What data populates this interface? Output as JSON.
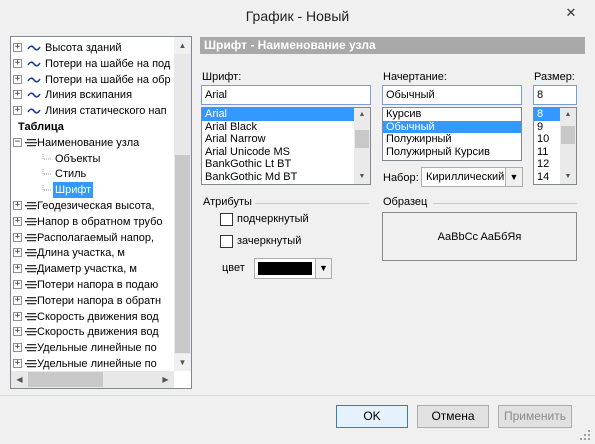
{
  "window": {
    "title": "График - Новый",
    "close_glyph": "✕"
  },
  "tree": {
    "items": [
      {
        "label": "Высота зданий",
        "kind": "series",
        "expander": "+"
      },
      {
        "label": "Потери на шайбе на под",
        "kind": "series",
        "expander": "+"
      },
      {
        "label": "Потери на шайбе на обр",
        "kind": "series",
        "expander": "+"
      },
      {
        "label": "Линия вскипания",
        "kind": "series",
        "expander": "+"
      },
      {
        "label": "Линия статического нап",
        "kind": "series",
        "expander": "+"
      },
      {
        "label": "Таблица",
        "kind": "heading"
      },
      {
        "label": "Наименование узла",
        "kind": "table-row",
        "expander": "−"
      },
      {
        "label": "Объекты",
        "kind": "child"
      },
      {
        "label": "Стиль",
        "kind": "child"
      },
      {
        "label": "Шрифт",
        "kind": "child",
        "selected": true
      },
      {
        "label": "Геодезическая высота,",
        "kind": "table-row",
        "expander": "+"
      },
      {
        "label": "Напор в обратном трубо",
        "kind": "table-row",
        "expander": "+"
      },
      {
        "label": "Располагаемый напор,",
        "kind": "table-row",
        "expander": "+"
      },
      {
        "label": "Длина участка, м",
        "kind": "table-row",
        "expander": "+"
      },
      {
        "label": "Диаметр участка, м",
        "kind": "table-row",
        "expander": "+"
      },
      {
        "label": "Потери напора в подаю",
        "kind": "table-row",
        "expander": "+"
      },
      {
        "label": "Потери напора в обратн",
        "kind": "table-row",
        "expander": "+"
      },
      {
        "label": "Скорость движения вод",
        "kind": "table-row",
        "expander": "+"
      },
      {
        "label": "Скорость движения вод",
        "kind": "table-row",
        "expander": "+"
      },
      {
        "label": "Удельные линейные по",
        "kind": "table-row",
        "expander": "+"
      },
      {
        "label": "Удельные линейные по",
        "kind": "table-row",
        "expander": "+"
      }
    ]
  },
  "panel": {
    "header": "Шрифт - Наименование узла",
    "font": {
      "label": "Шрифт:",
      "value": "Arial",
      "options": [
        "Arial",
        "Arial Black",
        "Arial Narrow",
        "Arial Unicode MS",
        "BankGothic Lt BT",
        "BankGothic Md BT"
      ],
      "selected": "Arial"
    },
    "style": {
      "label": "Начертание:",
      "value": "Обычный",
      "options": [
        "Курсив",
        "Обычный",
        "Полужирный",
        "Полужирный Курсив"
      ],
      "selected": "Обычный"
    },
    "size": {
      "label": "Размер:",
      "value": "8",
      "options": [
        "8",
        "9",
        "10",
        "11",
        "12",
        "14"
      ],
      "selected": "8"
    },
    "charset": {
      "label": "Набор:",
      "value": "Кириллический"
    },
    "attributes": {
      "label": "Атрибуты",
      "underline": {
        "label": "подчеркнутый",
        "checked": false
      },
      "strikeout": {
        "label": "зачеркнутый",
        "checked": false
      },
      "color": {
        "label": "цвет",
        "value": "#000000"
      }
    },
    "sample": {
      "label": "Образец",
      "text": "AaBbCc AaБбЯя"
    }
  },
  "buttons": {
    "ok": "OK",
    "cancel": "Отмена",
    "apply": "Применить"
  },
  "colors": {
    "selection": "#3399ff",
    "header_bg": "#a9a9a9",
    "window_bg": "#f0f0f0"
  }
}
